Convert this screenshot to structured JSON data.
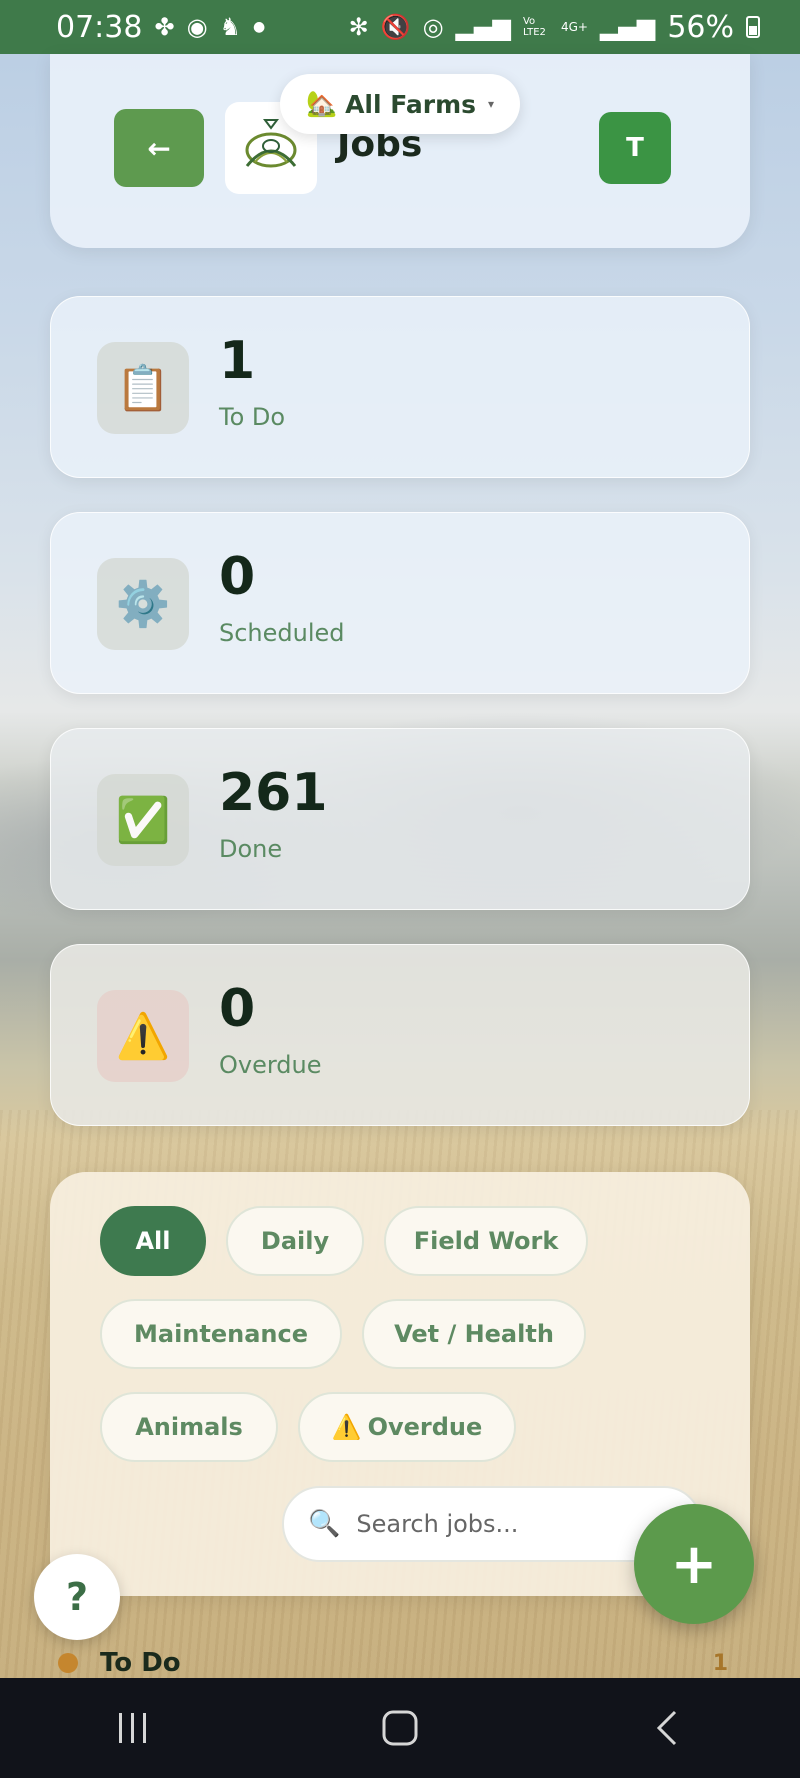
{
  "status_bar": {
    "time": "07:38",
    "battery": "56%",
    "left_icons": [
      "pinwheel-icon",
      "whatsapp-icon",
      "notification-icon",
      "dot-icon"
    ],
    "right_icons": [
      "bluetooth-icon",
      "mute-icon",
      "hotspot-icon",
      "signal-icon",
      "volte-icon",
      "4g-icon",
      "signal-icon",
      "battery-icon"
    ],
    "network_label": "4G+",
    "volte_label": "Vo LTE2"
  },
  "header": {
    "back_label": "←",
    "title": "Jobs",
    "avatar_initial": "T",
    "farm_selector": {
      "icon": "🏡",
      "label": "All Farms",
      "chevron": "▾"
    }
  },
  "stats": [
    {
      "icon": "📋",
      "icon_name": "clipboard-icon",
      "value": "1",
      "label": "To Do"
    },
    {
      "icon": "⚙️",
      "icon_name": "gear-icon",
      "value": "0",
      "label": "Scheduled"
    },
    {
      "icon": "✅",
      "icon_name": "check-icon",
      "value": "261",
      "label": "Done"
    },
    {
      "icon": "⚠️",
      "icon_name": "warning-icon",
      "value": "0",
      "label": "Overdue"
    }
  ],
  "filters": {
    "chips": [
      {
        "label": "All",
        "active": true
      },
      {
        "label": "Daily",
        "active": false
      },
      {
        "label": "Field Work",
        "active": false
      },
      {
        "label": "Maintenance",
        "active": false
      },
      {
        "label": "Vet / Health",
        "active": false
      },
      {
        "label": "Animals",
        "active": false
      },
      {
        "label": "Overdue",
        "icon": "⚠️",
        "active": false
      }
    ],
    "search": {
      "placeholder": "Search jobs...",
      "value": "",
      "icon": "🔍"
    }
  },
  "fab_label": "+",
  "help_label": "?",
  "section": {
    "title": "To Do",
    "count": "1"
  },
  "colors": {
    "brand_green": "#3f7a4a",
    "accent_green": "#5c9a4c",
    "section_dot": "#c5862e"
  }
}
